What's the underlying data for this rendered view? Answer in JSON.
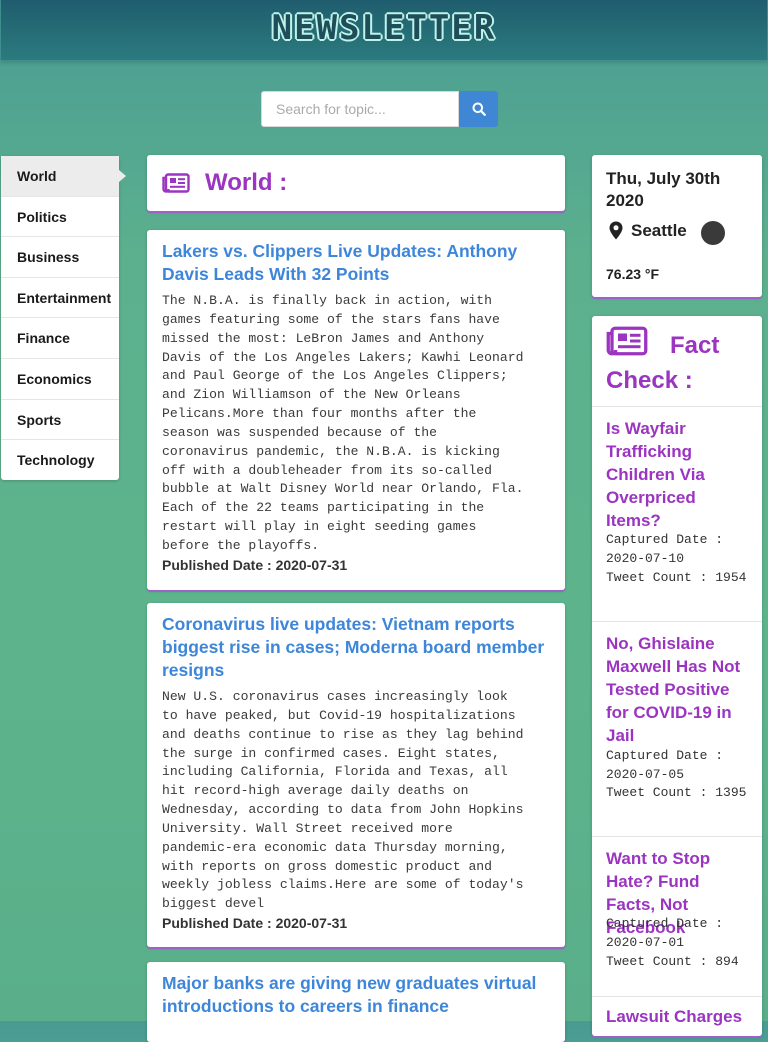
{
  "header": {
    "logo": "NEWSLETTER"
  },
  "search": {
    "placeholder": "Search for topic..."
  },
  "sidebar": {
    "items": [
      {
        "label": "World",
        "active": true
      },
      {
        "label": "Politics"
      },
      {
        "label": "Business"
      },
      {
        "label": "Entertainment"
      },
      {
        "label": "Finance"
      },
      {
        "label": "Economics"
      },
      {
        "label": "Sports"
      },
      {
        "label": "Technology"
      }
    ]
  },
  "section": {
    "title": "World :",
    "icon": "newspaper-icon"
  },
  "news": [
    {
      "title": "Lakers vs. Clippers Live Updates: Anthony Davis Leads With 32 Points",
      "body": "The N.B.A. is finally back in action, with\ngames featuring some of the stars fans have\nmissed the most: LeBron James and Anthony\nDavis of the Los Angeles Lakers; Kawhi Leonard\nand Paul George of the Los Angeles Clippers;\nand Zion Williamson of the New Orleans\nPelicans.More than four months after the\nseason was suspended because of the\ncoronavirus pandemic, the N.B.A. is kicking\noff with a doubleheader from its so-called\nbubble at Walt Disney World near Orlando, Fla.\nEach of the 22 teams participating in the\nrestart will play in eight seeding games\nbefore the playoffs.",
      "date": "Published Date : 2020-07-31"
    },
    {
      "title": "Coronavirus live updates: Vietnam reports biggest rise in cases; Moderna board member resigns",
      "body": "New U.S. coronavirus cases increasingly look\nto have peaked, but Covid-19 hospitalizations\nand deaths continue to rise as they lag behind\nthe surge in confirmed cases. Eight states,\nincluding California, Florida and Texas, all\nhit record-high average daily deaths on\nWednesday, according to data from John Hopkins\nUniversity. Wall Street received more\npandemic-era economic data Thursday morning,\nwith reports on gross domestic product and\nweekly jobless claims.Here are some of today's\nbiggest devel",
      "date": "Published Date : 2020-07-31"
    },
    {
      "title": "Major banks are giving new graduates virtual introductions to careers in finance"
    }
  ],
  "weather": {
    "date": "Thu, July 30th 2020",
    "city": "Seattle",
    "temp": "76.23 °F",
    "location_icon": "map-pin-icon",
    "condition_icon": "circle-icon"
  },
  "fact_check": {
    "title": "Fact Check :",
    "icon": "newspaper-icon",
    "items": [
      {
        "title": "Is Wayfair Trafficking Children Via Overpriced Items?",
        "captured": "Captured Date : 2020-07-10",
        "tweets": "Tweet Count : 1954"
      },
      {
        "title": "No, Ghislaine Maxwell Has Not Tested Positive for COVID-19 in Jail",
        "captured": "Captured Date : 2020-07-05",
        "tweets": "Tweet Count : 1395"
      },
      {
        "title": "Want to Stop Hate? Fund Facts, Not Facebook",
        "captured": "Captured Date : 2020-07-01",
        "tweets": "Tweet Count : 894"
      },
      {
        "title": "Lawsuit Charges"
      }
    ]
  },
  "colors": {
    "accent_purple": "#9b35c1",
    "link_blue": "#3d86d9",
    "search_button": "#3f86d4"
  }
}
